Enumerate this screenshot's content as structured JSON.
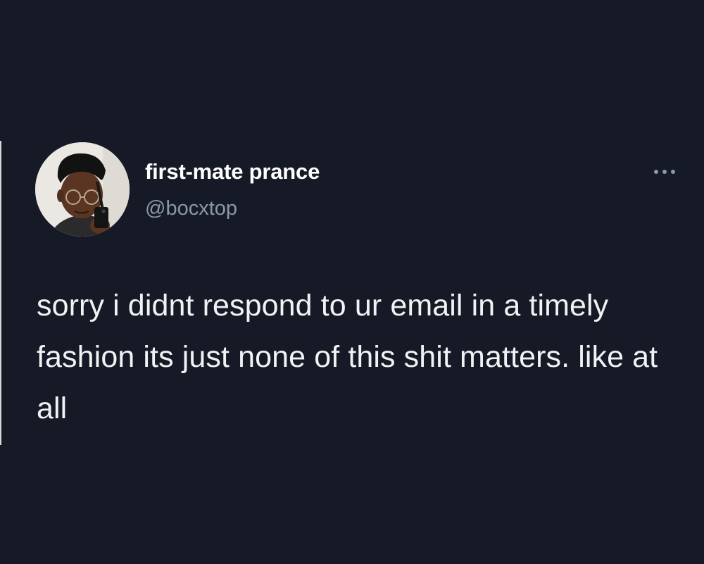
{
  "tweet": {
    "author": {
      "display_name": "first-mate prance",
      "handle": "@bocxtop",
      "avatar_icon": "profile-photo"
    },
    "more_icon": "ellipsis-icon",
    "text": "sorry i didnt respond to ur email in a timely fashion its just none of this shit matters. like at all"
  },
  "colors": {
    "background": "#151a26",
    "name": "#ffffff",
    "handle": "#8b98a5",
    "text": "#f0f2f3"
  }
}
